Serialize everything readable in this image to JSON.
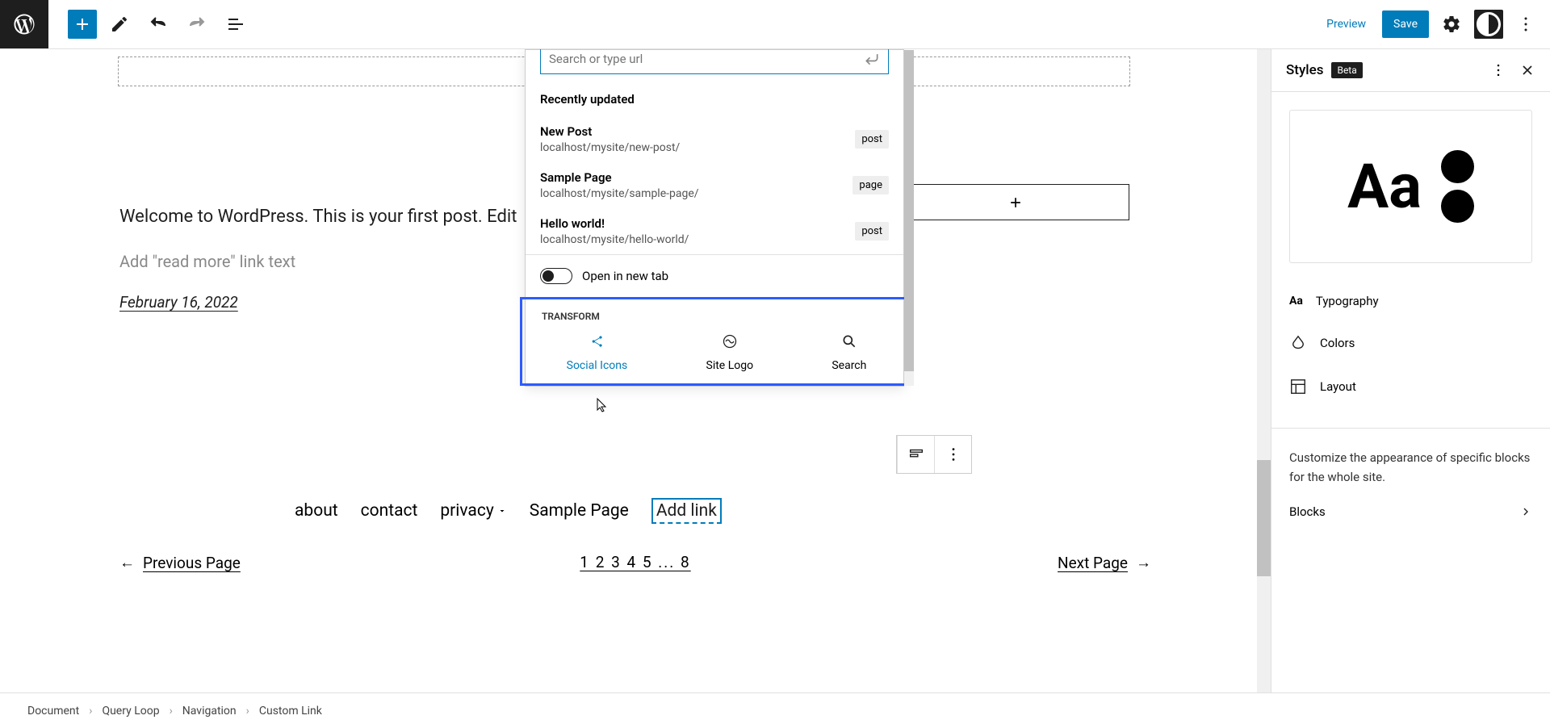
{
  "topbar": {
    "preview": "Preview",
    "save": "Save"
  },
  "canvas": {
    "post_intro": "Welcome to WordPress. This is your first post. Edit",
    "readmore": "Add \"read more\" link text",
    "date": "February 16, 2022",
    "nav": {
      "about": "about",
      "contact": "contact",
      "privacy": "privacy",
      "sample": "Sample Page",
      "addlink": "Add link"
    },
    "pagination": {
      "prev": "Previous Page",
      "next": "Next Page",
      "pages": "1 2 3 4 5 ... 8"
    }
  },
  "popup": {
    "search_placeholder": "Search or type url",
    "recent_title": "Recently updated",
    "items": [
      {
        "title": "New Post",
        "url": "localhost/mysite/new-post/",
        "type": "post"
      },
      {
        "title": "Sample Page",
        "url": "localhost/mysite/sample-page/",
        "type": "page"
      },
      {
        "title": "Hello world!",
        "url": "localhost/mysite/hello-world/",
        "type": "post"
      }
    ],
    "open_new_tab": "Open in new tab",
    "transform_title": "TRANSFORM",
    "transform": {
      "social": "Social Icons",
      "logo": "Site Logo",
      "search": "Search"
    }
  },
  "sidebar": {
    "title": "Styles",
    "beta": "Beta",
    "typography": "Typography",
    "colors": "Colors",
    "layout": "Layout",
    "custom_text": "Customize the appearance of specific blocks for the whole site.",
    "blocks": "Blocks"
  },
  "breadcrumb": {
    "doc": "Document",
    "query": "Query Loop",
    "nav": "Navigation",
    "custom": "Custom Link"
  }
}
